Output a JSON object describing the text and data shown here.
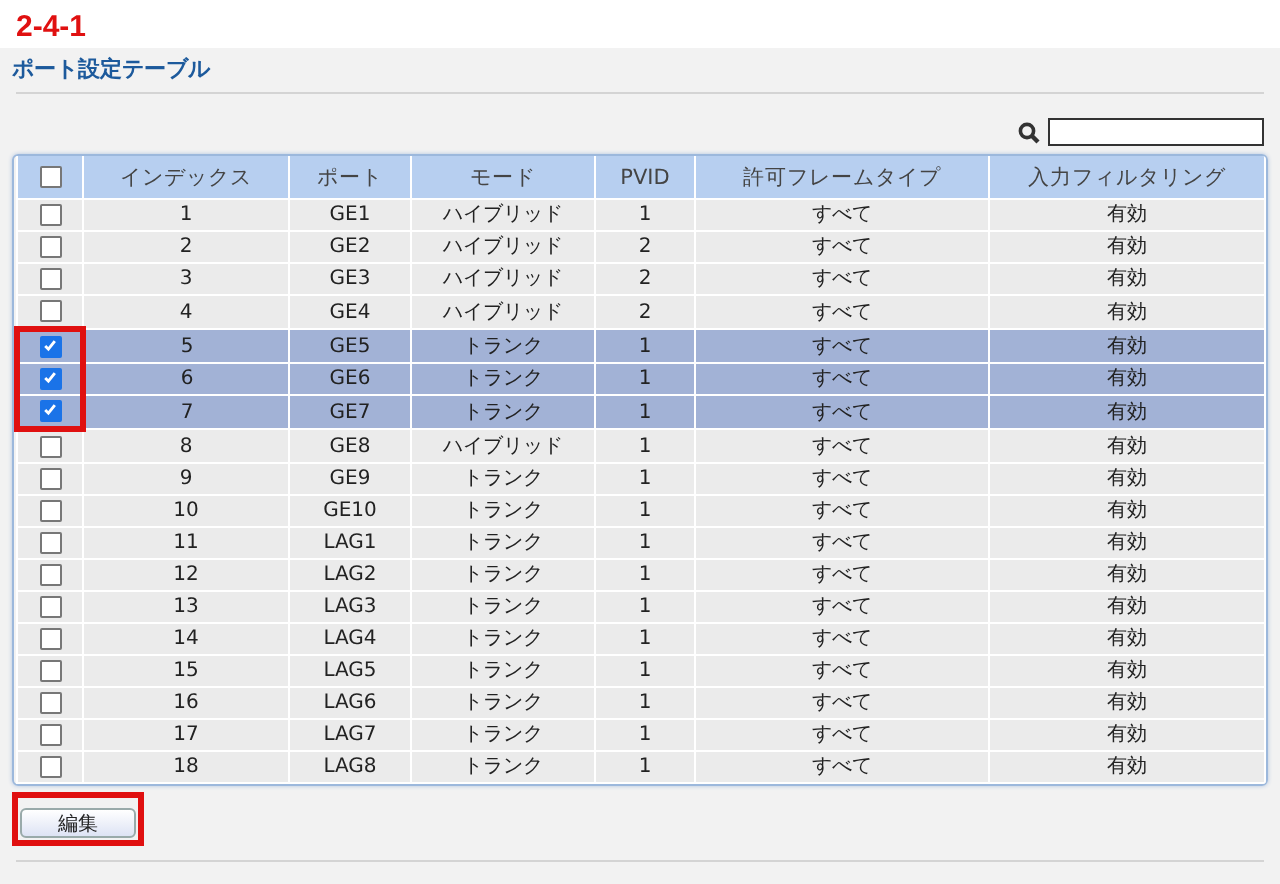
{
  "step_label": "2-4-1",
  "section_title": "ポート設定テーブル",
  "table": {
    "columns": [
      "インデックス",
      "ポート",
      "モード",
      "PVID",
      "許可フレームタイプ",
      "入力フィルタリング"
    ],
    "all_checked": false,
    "rows": [
      {
        "cells": [
          "1",
          "GE1",
          "ハイブリッド",
          "1",
          "すべて",
          "有効"
        ],
        "selected": false,
        "outlined": false
      },
      {
        "cells": [
          "2",
          "GE2",
          "ハイブリッド",
          "2",
          "すべて",
          "有効"
        ],
        "selected": false,
        "outlined": false
      },
      {
        "cells": [
          "3",
          "GE3",
          "ハイブリッド",
          "2",
          "すべて",
          "有効"
        ],
        "selected": false,
        "outlined": false
      },
      {
        "cells": [
          "4",
          "GE4",
          "ハイブリッド",
          "2",
          "すべて",
          "有効"
        ],
        "selected": false,
        "outlined": false
      },
      {
        "cells": [
          "5",
          "GE5",
          "トランク",
          "1",
          "すべて",
          "有効"
        ],
        "selected": true,
        "outlined": true
      },
      {
        "cells": [
          "6",
          "GE6",
          "トランク",
          "1",
          "すべて",
          "有効"
        ],
        "selected": true,
        "outlined": true
      },
      {
        "cells": [
          "7",
          "GE7",
          "トランク",
          "1",
          "すべて",
          "有効"
        ],
        "selected": true,
        "outlined": true
      },
      {
        "cells": [
          "8",
          "GE8",
          "ハイブリッド",
          "1",
          "すべて",
          "有効"
        ],
        "selected": false,
        "outlined": false
      },
      {
        "cells": [
          "9",
          "GE9",
          "トランク",
          "1",
          "すべて",
          "有効"
        ],
        "selected": false,
        "outlined": false
      },
      {
        "cells": [
          "10",
          "GE10",
          "トランク",
          "1",
          "すべて",
          "有効"
        ],
        "selected": false,
        "outlined": false
      },
      {
        "cells": [
          "11",
          "LAG1",
          "トランク",
          "1",
          "すべて",
          "有効"
        ],
        "selected": false,
        "outlined": false
      },
      {
        "cells": [
          "12",
          "LAG2",
          "トランク",
          "1",
          "すべて",
          "有効"
        ],
        "selected": false,
        "outlined": false
      },
      {
        "cells": [
          "13",
          "LAG3",
          "トランク",
          "1",
          "すべて",
          "有効"
        ],
        "selected": false,
        "outlined": false
      },
      {
        "cells": [
          "14",
          "LAG4",
          "トランク",
          "1",
          "すべて",
          "有効"
        ],
        "selected": false,
        "outlined": false
      },
      {
        "cells": [
          "15",
          "LAG5",
          "トランク",
          "1",
          "すべて",
          "有効"
        ],
        "selected": false,
        "outlined": false
      },
      {
        "cells": [
          "16",
          "LAG6",
          "トランク",
          "1",
          "すべて",
          "有効"
        ],
        "selected": false,
        "outlined": false
      },
      {
        "cells": [
          "17",
          "LAG7",
          "トランク",
          "1",
          "すべて",
          "有効"
        ],
        "selected": false,
        "outlined": false
      },
      {
        "cells": [
          "18",
          "LAG8",
          "トランク",
          "1",
          "すべて",
          "有効"
        ],
        "selected": false,
        "outlined": false
      }
    ]
  },
  "edit_button": {
    "label": "編集",
    "outlined": true
  }
}
